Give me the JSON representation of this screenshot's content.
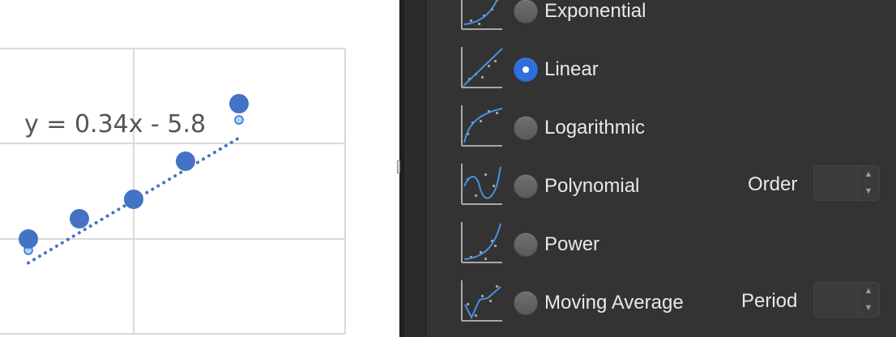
{
  "chart": {
    "trendline_equation": "y = 0.34x - 5.8"
  },
  "chart_data": {
    "type": "scatter",
    "title": "",
    "xlabel": "",
    "ylabel": "",
    "trendline": {
      "type": "linear",
      "style": "dotted",
      "equation": "y = 0.34x - 5.8"
    },
    "series": [
      {
        "values": [
          [
            1,
            1.2
          ],
          [
            2,
            1.6
          ],
          [
            3,
            2.0
          ],
          [
            4,
            2.8
          ],
          [
            5,
            4.2
          ]
        ]
      }
    ],
    "xlim": [
      1,
      6.2
    ],
    "ylim": [
      0.2,
      5.1
    ],
    "grid": true,
    "colors": {
      "marker": "#4472c4",
      "trendline": "#4472c4",
      "grid": "#d9d9d9"
    }
  },
  "trendline_options": {
    "items": [
      {
        "label": "Exponential",
        "icon": "exponential-trend-icon",
        "selected": false
      },
      {
        "label": "Linear",
        "icon": "linear-trend-icon",
        "selected": true
      },
      {
        "label": "Logarithmic",
        "icon": "logarithmic-trend-icon",
        "selected": false
      },
      {
        "label": "Polynomial",
        "icon": "polynomial-trend-icon",
        "selected": false
      },
      {
        "label": "Power",
        "icon": "power-trend-icon",
        "selected": false
      },
      {
        "label": "Moving Average",
        "icon": "moving-average-trend-icon",
        "selected": false
      }
    ],
    "order_label": "Order",
    "order_value": "",
    "period_label": "Period",
    "period_value": ""
  },
  "colors": {
    "panel_bg": "#333333",
    "accent": "#2f6fdc",
    "text": "#e8e8e8"
  }
}
